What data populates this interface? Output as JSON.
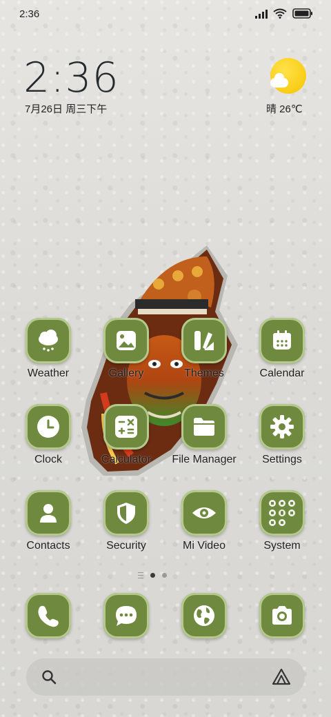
{
  "status_bar": {
    "time": "2:36"
  },
  "clock_widget": {
    "time": "2:36",
    "date": "7月26日 周三下午"
  },
  "weather_widget": {
    "condition_temp": "晴 26℃",
    "icon": "sunny-cloud-icon"
  },
  "accent_color": "#6f8a3f",
  "apps": [
    {
      "label": "Weather",
      "icon": "weather-icon"
    },
    {
      "label": "Gallery",
      "icon": "gallery-icon"
    },
    {
      "label": "Themes",
      "icon": "themes-icon"
    },
    {
      "label": "Calendar",
      "icon": "calendar-icon"
    },
    {
      "label": "Clock",
      "icon": "clock-icon"
    },
    {
      "label": "Calculator",
      "icon": "calculator-icon"
    },
    {
      "label": "File Manager",
      "icon": "folder-icon"
    },
    {
      "label": "Settings",
      "icon": "gear-icon"
    },
    {
      "label": "Contacts",
      "icon": "contacts-icon"
    },
    {
      "label": "Security",
      "icon": "shield-icon"
    },
    {
      "label": "Mi Video",
      "icon": "eye-icon"
    },
    {
      "label": "System",
      "icon": "system-folder-icon"
    }
  ],
  "dock": [
    {
      "name": "phone",
      "icon": "phone-icon"
    },
    {
      "name": "messages",
      "icon": "chat-icon"
    },
    {
      "name": "browser",
      "icon": "globe-icon"
    },
    {
      "name": "camera",
      "icon": "camera-icon"
    }
  ],
  "search": {
    "icon": "search-icon",
    "assistant_icon": "assistant-icon"
  }
}
